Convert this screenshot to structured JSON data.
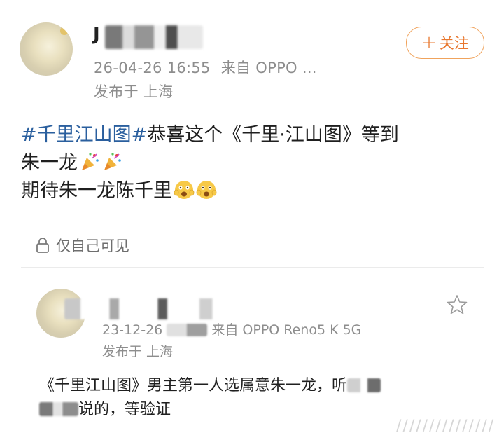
{
  "post1": {
    "username_visible": "J",
    "timestamp": "26-04-26 16:55",
    "source": "来自 OPPO ...",
    "location": "发布于 上海",
    "follow_label": "关注",
    "content": {
      "hashtag1": "#千里江山图#",
      "line1_rest": "恭喜这个《千里·江山图》等到",
      "line2": "朱一龙",
      "line3": "期待朱一龙陈千里"
    },
    "visibility": "仅自己可见"
  },
  "post2": {
    "timestamp": "23-12-26",
    "source": "来自 OPPO Reno5 K 5G",
    "location": "发布于 上海",
    "content_line1": "《千里江山图》男主第一人选属意朱一龙，听",
    "content_line2": "说的，等验证"
  },
  "watermark": "///////////////",
  "colors": {
    "hashtag": "#2a5f9e",
    "follow": "#e8772e",
    "meta": "#8d8d8d"
  }
}
